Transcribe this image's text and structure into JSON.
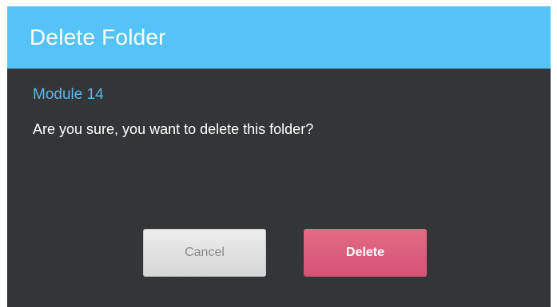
{
  "dialog": {
    "title": "Delete Folder",
    "folder_name": "Module 14",
    "message": "Are you sure, you want to delete this folder?",
    "cancel_label": "Cancel",
    "delete_label": "Delete"
  },
  "colors": {
    "header": "#55c3f7",
    "body": "#333536",
    "folder_name": "#5ab8ea",
    "delete_button": "#d9607c",
    "cancel_button": "#e2e2e2"
  }
}
